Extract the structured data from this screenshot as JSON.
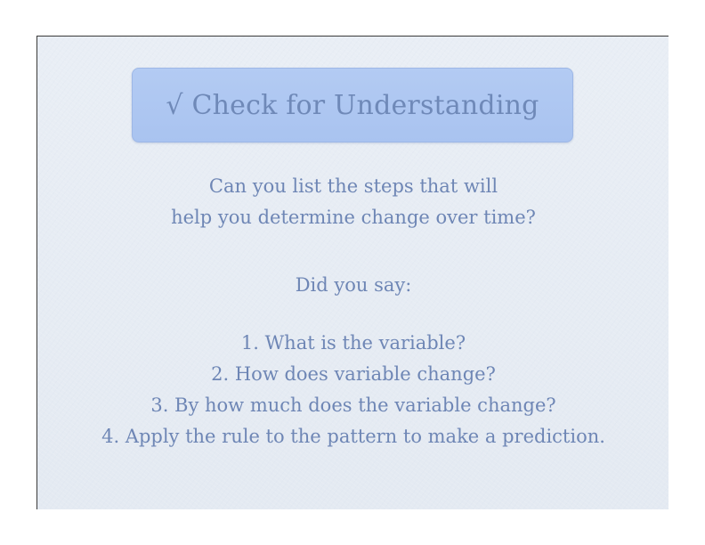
{
  "slide": {
    "title": "√  Check for Understanding",
    "question_lines": [
      "Can you list the steps that will",
      "help you determine change over time?"
    ],
    "prompt": "Did you say:",
    "steps": [
      "1. What is the variable?",
      "2.  How does variable change?",
      "3.  By how much does the variable change?",
      "4.  Apply the rule to the pattern to make a prediction."
    ],
    "colors": {
      "text": "#6e86b5",
      "title_box": "#afc7f2",
      "background": "#e7ecf4"
    }
  }
}
